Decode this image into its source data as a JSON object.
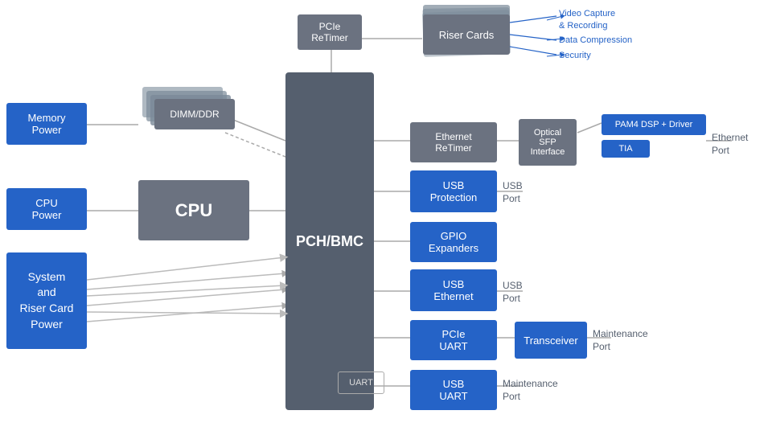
{
  "boxes": {
    "memory_power": {
      "label": "Memory\nPower"
    },
    "cpu_power": {
      "label": "CPU\nPower"
    },
    "system_riser_power": {
      "label": "System\nand\nRiser Card\nPower"
    },
    "dimm_ddr": {
      "label": "DIMM/DDR"
    },
    "cpu": {
      "label": "CPU"
    },
    "pch_bmc": {
      "label": "PCH/BMC"
    },
    "pcie_retimer": {
      "label": "PCIe\nReTimer"
    },
    "riser_cards": {
      "label": "Riser Cards"
    },
    "ethernet_retimer": {
      "label": "Ethernet\nReTimer"
    },
    "optical_sfp": {
      "label": "Optical\nSFP\nInterface"
    },
    "pam4": {
      "label": "PAM4 DSP + Driver"
    },
    "tia": {
      "label": "TIA"
    },
    "usb_protection": {
      "label": "USB\nProtection"
    },
    "gpio_expanders": {
      "label": "GPIO\nExpanders"
    },
    "usb_ethernet": {
      "label": "USB\nEthernet"
    },
    "pcie_uart": {
      "label": "PCIe\nUART"
    },
    "transceiver": {
      "label": "Transceiver"
    },
    "usb_uart": {
      "label": "USB\nUART"
    },
    "uart_outline": {
      "label": "UART"
    },
    "video_capture": {
      "label": "Video Capture\n& Recording"
    },
    "data_compression": {
      "label": "Data Compression"
    },
    "security_label": {
      "label": "Security"
    },
    "usb_port1": {
      "label": "USB\nPort"
    },
    "usb_port2": {
      "label": "USB\nPort"
    },
    "maintenance_port1": {
      "label": "Maintenance\nPort"
    },
    "maintenance_port2": {
      "label": "Maintenance\nPort"
    },
    "ethernet_port": {
      "label": "Ethernet\nPort"
    }
  }
}
